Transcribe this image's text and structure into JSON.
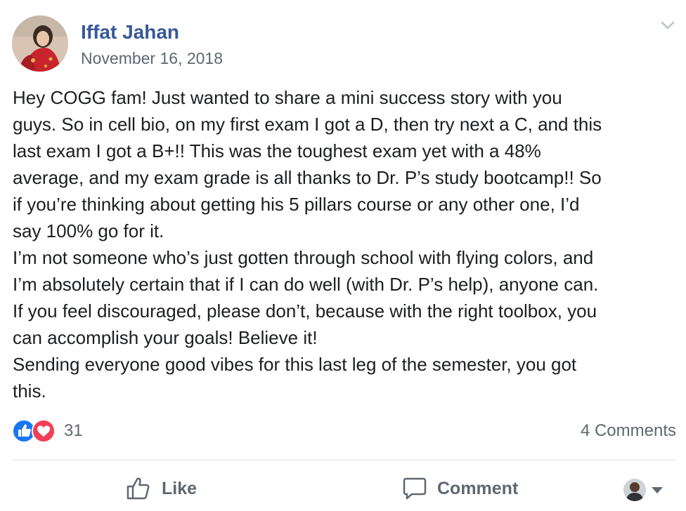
{
  "post": {
    "author_name": "Iffat Jahan",
    "timestamp": "November 16, 2018",
    "body_lines": [
      "Hey COGG fam! Just wanted to share a mini success story with you",
      "guys. So in cell bio, on my first exam I got a D, then try next a C, and this",
      "last exam I got a B+!! This was the toughest exam yet with a 48%",
      "average, and my exam grade is all thanks to Dr. P’s study bootcamp!! So",
      "if you’re thinking about getting his 5 pillars course or any other one, I’d",
      "say 100% go for it.",
      "I’m not someone who’s just gotten through school with flying colors, and",
      "I’m absolutely certain that if I can do well (with Dr. P’s help), anyone can.",
      "If you feel discouraged, please don’t, because with the right toolbox, you",
      "can accomplish your goals! Believe it!",
      "Sending everyone good vibes for this last leg of the semester, you got",
      "this."
    ]
  },
  "reactions": {
    "icons": [
      "like-icon",
      "love-icon"
    ],
    "count": "31"
  },
  "comments": {
    "count_label": "4 Comments"
  },
  "actions": {
    "like_label": "Like",
    "comment_label": "Comment"
  },
  "icons": {
    "menu": "chevron-down-icon",
    "audience_caret": "caret-down-icon"
  },
  "colors": {
    "author_link": "#385898",
    "secondary_text": "#606770",
    "like_blue": "#1877f2",
    "love_red": "#f33e58",
    "divider": "#dadde1"
  }
}
